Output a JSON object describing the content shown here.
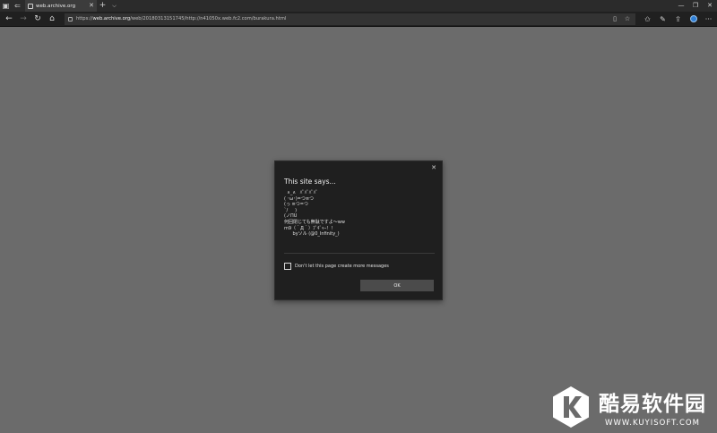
{
  "tab": {
    "title": "web.archive.org",
    "favicon": "page-icon",
    "close_label": "✕"
  },
  "tabstrip": {
    "new_tab_label": "+",
    "tabs_menu_label": "⌵"
  },
  "window_controls": {
    "minimize": "—",
    "maximize": "❐",
    "close": "✕"
  },
  "address": {
    "url_prefix": "https://",
    "url_host": "web.archive.org",
    "url_path": "/web/20180313151745/http://n41050x.web.fc2.com/burakura.html"
  },
  "dialog": {
    "title": "This site says...",
    "close_label": "✕",
    "message_lines": [
      "  ∧_∧   ﾊﾟﾊﾟﾊﾟﾊﾟ",
      "( ･ω･)=つ≡つ",
      "(っ ≡つ=つ",
      "`/     )",
      "(ノΠU",
      "何回閉じても無駄ですよ～ww",
      "m9（＾Д＾）ﾌﾟｷﾞｬｰ！！",
      "      byソル (@0_Infinity_)"
    ],
    "checkbox_label": "Don't let this page create more messages",
    "ok_label": "OK"
  },
  "watermark": {
    "title": "酷易软件园",
    "url": "WWW.KUYISOFT.COM",
    "logo_letter": "K"
  },
  "colors": {
    "page_background": "#6b6b6b",
    "dialog_background": "#1f1f1f",
    "ok_button": "#4b4b4b",
    "watermark_logo": "#ffffff"
  }
}
